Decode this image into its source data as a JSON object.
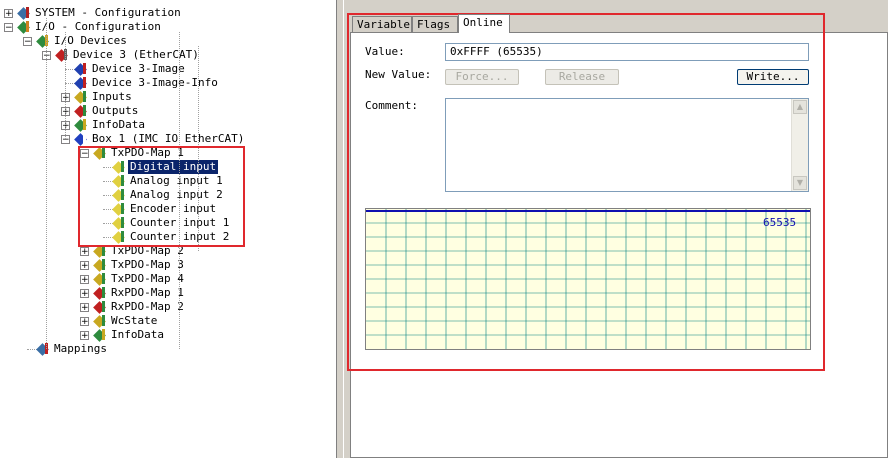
{
  "tree": {
    "nodes": [
      {
        "label": "SYSTEM - Configuration",
        "expander": "+",
        "icon": "system-config-icon"
      },
      {
        "label": "I/O - Configuration",
        "expander": "-",
        "icon": "io-config-icon"
      },
      {
        "label": "I/O Devices",
        "expander": "-",
        "icon": "io-devices-icon"
      },
      {
        "label": "Device 3 (EtherCAT)",
        "expander": "-",
        "icon": "ethercat-device-icon"
      },
      {
        "label": "Device 3-Image",
        "expander": "",
        "icon": "image-icon"
      },
      {
        "label": "Device 3-Image-Info",
        "expander": "",
        "icon": "image-info-icon"
      },
      {
        "label": "Inputs",
        "expander": "+",
        "icon": "inputs-icon"
      },
      {
        "label": "Outputs",
        "expander": "+",
        "icon": "outputs-icon"
      },
      {
        "label": "InfoData",
        "expander": "+",
        "icon": "infodata-icon"
      },
      {
        "label": "Box 1 (IMC IO EtherCAT)",
        "expander": "-",
        "icon": "box-icon"
      },
      {
        "label": "TxPDO-Map 1",
        "expander": "-",
        "icon": "txpdo-icon"
      },
      {
        "label": "Digital input",
        "expander": "",
        "icon": "input-variable-icon",
        "selected": true
      },
      {
        "label": "Analog input 1",
        "expander": "",
        "icon": "input-variable-icon"
      },
      {
        "label": "Analog input 2",
        "expander": "",
        "icon": "input-variable-icon"
      },
      {
        "label": "Encoder input",
        "expander": "",
        "icon": "input-variable-icon"
      },
      {
        "label": "Counter input 1",
        "expander": "",
        "icon": "input-variable-icon"
      },
      {
        "label": "Counter input 2",
        "expander": "",
        "icon": "input-variable-icon"
      },
      {
        "label": "TxPDO-Map 2",
        "expander": "+",
        "icon": "txpdo-icon"
      },
      {
        "label": "TxPDO-Map 3",
        "expander": "+",
        "icon": "txpdo-icon"
      },
      {
        "label": "TxPDO-Map 4",
        "expander": "+",
        "icon": "txpdo-icon"
      },
      {
        "label": "RxPDO-Map 1",
        "expander": "+",
        "icon": "rxpdo-icon"
      },
      {
        "label": "RxPDO-Map 2",
        "expander": "+",
        "icon": "rxpdo-icon"
      },
      {
        "label": "WcState",
        "expander": "+",
        "icon": "wcstate-icon"
      },
      {
        "label": "InfoData",
        "expander": "+",
        "icon": "infodata-icon"
      },
      {
        "label": "Mappings",
        "expander": "",
        "icon": "mappings-icon"
      }
    ]
  },
  "tabs": [
    {
      "label": "Variable",
      "active": false
    },
    {
      "label": "Flags",
      "active": false
    },
    {
      "label": "Online",
      "active": true
    }
  ],
  "online": {
    "value_label": "Value:",
    "value": "0xFFFF (65535)",
    "new_value_label": "New Value:",
    "force_label": "Force...",
    "release_label": "Release",
    "write_label": "Write...",
    "comment_label": "Comment:",
    "comment_value": "",
    "graph_value_label": "65535"
  },
  "colors": {
    "selection": "#0a246a",
    "highlight_box": "#e0282d",
    "graph_background": "#ffffe1",
    "graph_grid": "#008080",
    "graph_line": "#1010b0"
  }
}
